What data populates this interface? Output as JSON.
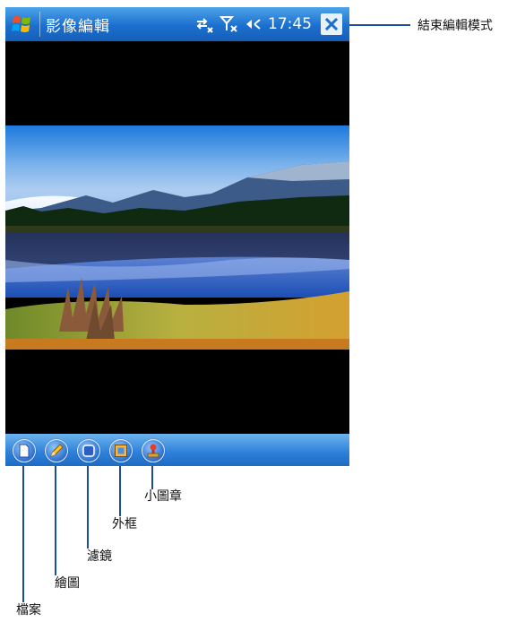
{
  "titlebar": {
    "app_title": "影像編輯",
    "clock": "17:45"
  },
  "callouts": {
    "exit_edit_mode": "結束編輯模式",
    "stamp": "小圖章",
    "frame": "外框",
    "filter": "濾鏡",
    "draw": "繪圖",
    "file": "檔案"
  },
  "icons": {
    "start": "windows-flag-icon",
    "sync": "sync-arrows-icon",
    "signal": "no-signal-icon",
    "volume": "speaker-muted-icon",
    "close": "close-icon",
    "toolbar": [
      "file-icon",
      "pencil-icon",
      "filter-square-icon",
      "frame-icon",
      "stamp-icon"
    ]
  },
  "colors": {
    "titlebar": "#1b6fcf",
    "toolbar": "#2c7fd8",
    "callout_line": "#1a4d9e"
  }
}
